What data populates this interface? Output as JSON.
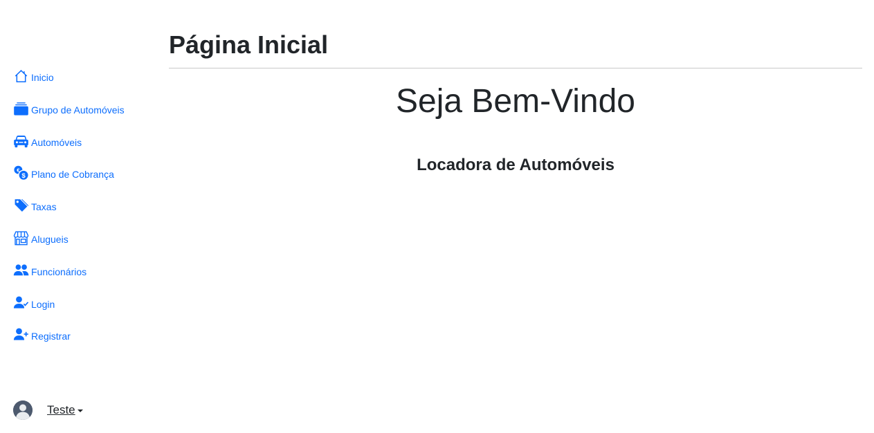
{
  "sidebar": {
    "items": [
      {
        "label": "Inicio",
        "icon": "house-icon"
      },
      {
        "label": "Grupo de Automóveis",
        "icon": "collection-icon"
      },
      {
        "label": "Automóveis",
        "icon": "car-icon"
      },
      {
        "label": "Plano de Cobrança",
        "icon": "coins-icon"
      },
      {
        "label": "Taxas",
        "icon": "tags-icon"
      },
      {
        "label": "Alugueis",
        "icon": "shop-icon"
      },
      {
        "label": "Funcionários",
        "icon": "people-icon"
      },
      {
        "label": "Login",
        "icon": "person-check-icon"
      },
      {
        "label": "Registrar",
        "icon": "person-plus-icon"
      }
    ],
    "user": {
      "name": "Teste",
      "avatar": "avatar-icon"
    }
  },
  "main": {
    "title": "Página Inicial",
    "welcome": "Seja Bem-Vindo",
    "subtitle": "Locadora de Automóveis"
  },
  "colors": {
    "link": "#0d6efd",
    "text": "#212529",
    "divider": "#c8c8c8"
  }
}
